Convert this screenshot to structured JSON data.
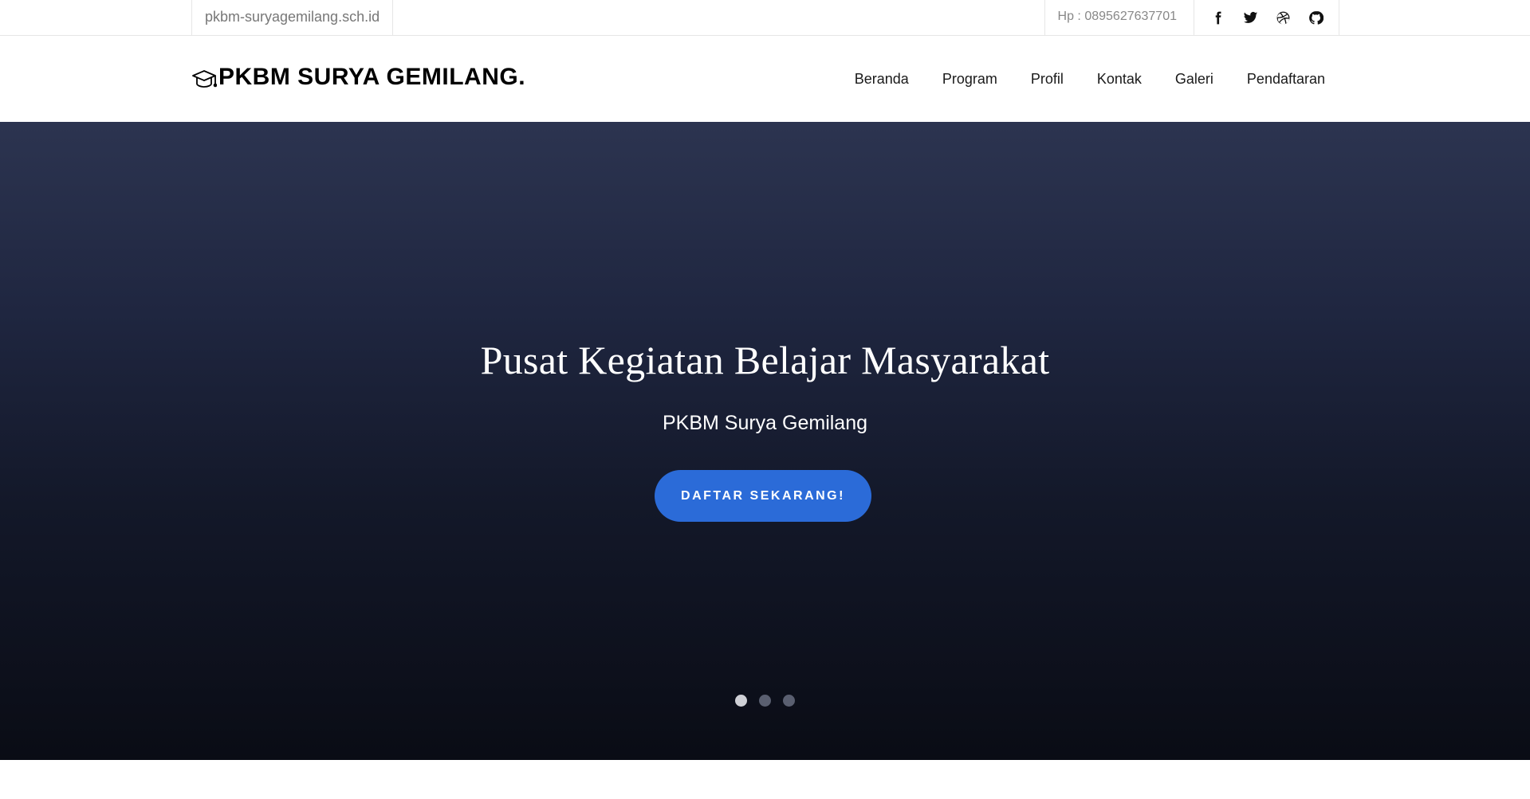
{
  "topbar": {
    "site_url": "pkbm-suryagemilang.sch.id",
    "phone": "Hp : 0895627637701",
    "socials": [
      {
        "icon": "facebook-icon"
      },
      {
        "icon": "twitter-icon"
      },
      {
        "icon": "dribbble-icon"
      },
      {
        "icon": "github-icon"
      }
    ]
  },
  "navbar": {
    "brand_icon": "graduation-cap-icon",
    "brand": "PKBM SURYA GEMILANG.",
    "items": [
      {
        "label": "Beranda"
      },
      {
        "label": "Program"
      },
      {
        "label": "Profil"
      },
      {
        "label": "Kontak"
      },
      {
        "label": "Galeri"
      },
      {
        "label": "Pendaftaran"
      }
    ]
  },
  "hero": {
    "title": "Pusat Kegiatan Belajar Masyarakat",
    "subtitle": "PKBM Surya Gemilang",
    "cta_label": "DAFTAR SEKARANG!",
    "slides_total": 3,
    "active_slide": 1
  },
  "colors": {
    "accent": "#2b6bd8",
    "hero_top": "#2c3450",
    "hero_bottom": "#0a0c15"
  }
}
